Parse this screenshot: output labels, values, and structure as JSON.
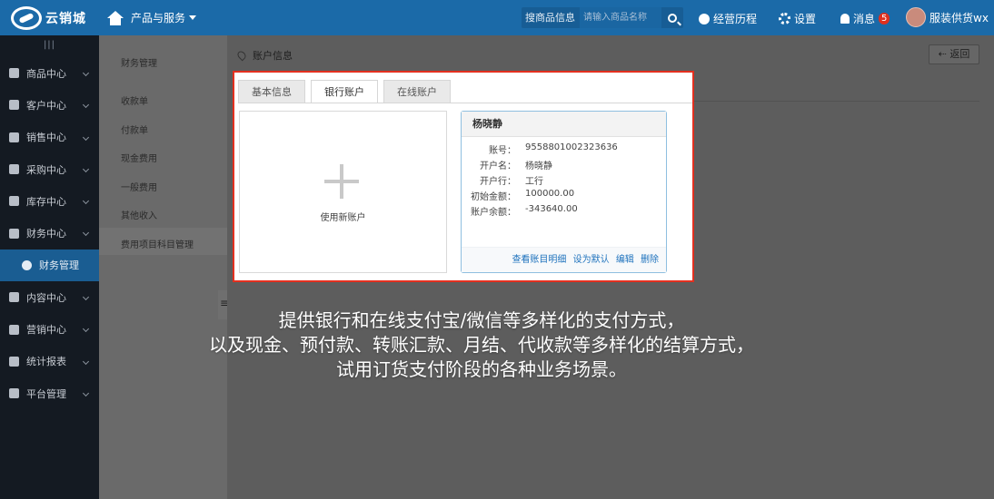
{
  "topbar": {
    "logo_text": "云销城",
    "nav_label": "产品与服务",
    "search_type": "搜商品信息",
    "search_placeholder": "请输入商品名称",
    "history_label": "经营历程",
    "settings_label": "设置",
    "messages_label": "消息",
    "messages_count": "5",
    "user_label": "服装供货wx"
  },
  "sidebar": {
    "collapse_glyph": "|||",
    "items": [
      {
        "label": "商品中心",
        "icon": "basket-icon"
      },
      {
        "label": "客户中心",
        "icon": "user-icon"
      },
      {
        "label": "销售中心",
        "icon": "cart-icon"
      },
      {
        "label": "采购中心",
        "icon": "purchase-icon"
      },
      {
        "label": "库存中心",
        "icon": "layers-icon"
      },
      {
        "label": "财务中心",
        "icon": "finance-icon"
      },
      {
        "label": "财务管理",
        "icon": "money-bag-icon"
      },
      {
        "label": "内容中心",
        "icon": "content-icon"
      },
      {
        "label": "营销中心",
        "icon": "tag-icon"
      },
      {
        "label": "统计报表",
        "icon": "bar-chart-icon"
      },
      {
        "label": "平台管理",
        "icon": "monitor-icon"
      }
    ]
  },
  "submenu": {
    "title": "财务管理",
    "links": [
      "收款单",
      "付款单",
      "现金费用",
      "一般费用",
      "其他收入",
      "费用项目科目管理"
    ]
  },
  "main": {
    "breadcrumb": "账户信息",
    "back_label": "返回"
  },
  "card": {
    "tabs": [
      "基本信息",
      "银行账户",
      "在线账户"
    ],
    "active_tab": "银行账户",
    "new_account_label": "使用新账户",
    "account": {
      "name": "杨晓静",
      "rows": [
        {
          "k": "账号：",
          "v": "9558801002323636"
        },
        {
          "k": "开户名：",
          "v": "杨晓静"
        },
        {
          "k": "开户行：",
          "v": "工行"
        },
        {
          "k": "初始金额：",
          "v": "100000.00"
        },
        {
          "k": "账户余额：",
          "v": "-343640.00"
        }
      ],
      "actions": [
        "查看账目明细",
        "设为默认",
        "编辑",
        "删除"
      ]
    }
  },
  "caption": {
    "line1": "提供银行和在线支付宝/微信等多样化的支付方式，",
    "line2": "以及现金、预付款、转账汇款、月结、代收款等多样化的结算方式，",
    "line3": "试用订货支付阶段的各种业务场景。"
  }
}
